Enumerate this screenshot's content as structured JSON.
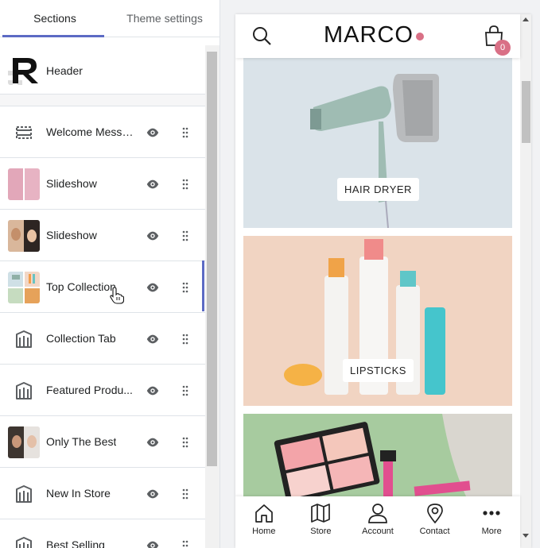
{
  "tabs": [
    {
      "label": "Sections",
      "active": true
    },
    {
      "label": "Theme settings",
      "active": false
    }
  ],
  "header_section": {
    "label": "Header"
  },
  "sections": [
    {
      "label": "Welcome Messa...",
      "icon": "announcement-bar-icon"
    },
    {
      "label": "Slideshow",
      "icon": "pink-image-thumbnail"
    },
    {
      "label": "Slideshow",
      "icon": "model-image-thumbnail"
    },
    {
      "label": "Top Collection",
      "icon": "collection-image-thumbnail",
      "active": true
    },
    {
      "label": "Collection Tab",
      "icon": "collection-icon"
    },
    {
      "label": "Featured Produ...",
      "icon": "collection-icon"
    },
    {
      "label": "Only The Best",
      "icon": "model-image-thumbnail"
    },
    {
      "label": "New In Store",
      "icon": "collection-icon"
    },
    {
      "label": "Best Selling",
      "icon": "collection-icon"
    }
  ],
  "preview": {
    "logo": "MARCO",
    "cart_count": "0",
    "cards": [
      {
        "label": "HAIR DRYER"
      },
      {
        "label": "LIPSTICKS"
      },
      {
        "label": ""
      }
    ],
    "nav": [
      {
        "label": "Home",
        "icon": "home-icon"
      },
      {
        "label": "Store",
        "icon": "map-icon"
      },
      {
        "label": "Account",
        "icon": "user-icon"
      },
      {
        "label": "Contact",
        "icon": "location-pin-icon"
      },
      {
        "label": "More",
        "icon": "more-dots-icon"
      }
    ]
  },
  "colors": {
    "accent": "#5c6ac4",
    "badge": "#d97086"
  }
}
